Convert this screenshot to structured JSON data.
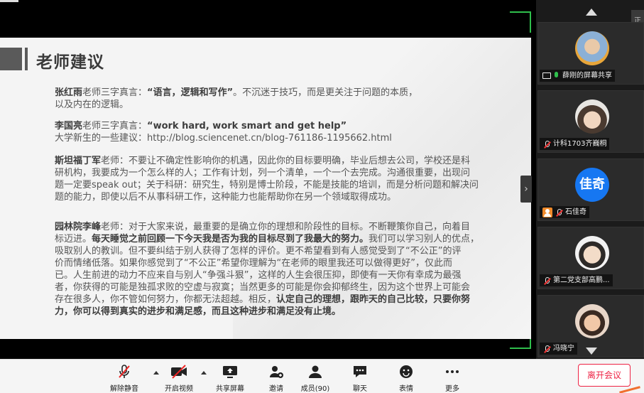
{
  "slide": {
    "title": "老师建议",
    "p1_name": "张红雨",
    "p1_text": "老师三字真言：",
    "p1_quote": "“语言，逻辑和写作”",
    "p1_rest": "。不沉迷于技巧，而是更关注于问题的本质，",
    "p1_line2": "以及内在的逻辑。",
    "p2_name": "李国亮",
    "p2_text": "老师三字真言：",
    "p2_quote": "“work hard, work smart and get help”",
    "p2_line2": "大学新生的一些建议：http://blog.sciencenet.cn/blog-761186-1195662.html",
    "p3_name": "斯坦福丁军",
    "p3_l1": "老师：不要让不确定性影响你的机遇，因此你的目标要明确，毕业后想去公司，学校还是科",
    "p3_l2": "研机构，我要成为一个怎么样的人；工作有计划，列一个清单，一个一个去完成。沟通很重要，出现问",
    "p3_l3": "题一定要speak out；关于科研：研究生，特别是博士阶段，不能是技能的培训，而是分析问题和解决问",
    "p3_l4": "题的能力，即使以后不从事科研工作，这种能力也能帮助你在另一个领域取得成功。",
    "p4_name": "园林院李峰",
    "p4_l1a": "老师：对于大家来说，最重要的是确立你的理想和阶段性的目标。不断鞭策你自己，向着目",
    "p4_l2a": "标迈进。",
    "p4_l2b": "每天睡觉之前回顾一下今天我是否为我的目标尽到了我最大的努力。",
    "p4_l2c": "我们可以学习别人的优点，",
    "p4_l3": "吸取别人的教训。但不要纠结于别人获得了怎样的评价。更不希望看到有人感觉受到了“不公正”的评",
    "p4_l4": "价而情绪低落。如果你感觉到了“不公正”希望你理解为“在老师的眼里我还可以做得更好”，仅此而",
    "p4_l5": "已。人生前进的动力不应来自与别人“争强斗狠”，这样的人生会很压抑，即使有一天你有幸成为最强",
    "p4_l6": "者，你获得的可能是独孤求败的空虚与寂寞；当然更多的可能是你会抑郁终生，因为这个世界上可能会",
    "p4_l7a": "存在很多人，你不管如何努力，你都无法超越。相反，",
    "p4_l7b": "认定自己的理想，跟昨天的自己比较，只要你努",
    "p4_l8": "力，你可以得到真实的进步和满足感，而且这种进步和满足没有止境。"
  },
  "participants": [
    {
      "name": "薛刚的屏幕共享",
      "status": "sharing"
    },
    {
      "name": "计科1703齐巍桐",
      "status": "muted"
    },
    {
      "name": "石佳奇",
      "initials": "佳奇",
      "status": "muted"
    },
    {
      "name": "第二党支部高鹏...",
      "status": "muted"
    },
    {
      "name": "冯晓宁",
      "status": "muted"
    }
  ],
  "side_tab_label": "正",
  "toolbar": {
    "unmute": "解除静音",
    "start_video": "开启视频",
    "share_screen": "共享屏幕",
    "invite": "邀请",
    "members": "成员(90)",
    "chat": "聊天",
    "reactions": "表情",
    "more": "更多",
    "leave": "离开会议"
  },
  "colors": {
    "accent_green": "#2fbf4c",
    "danger_red": "#e22244",
    "avatar_blue": "#1677f2"
  }
}
